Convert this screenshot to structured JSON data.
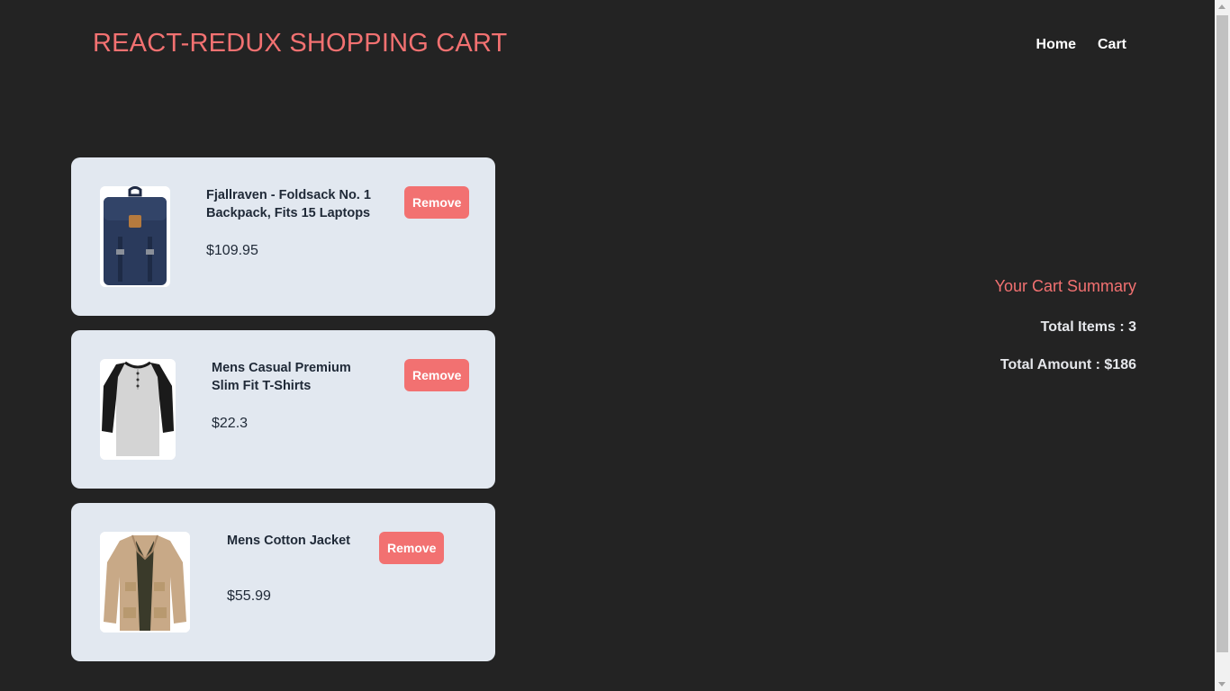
{
  "header": {
    "brand": "REACT-REDUX SHOPPING CART",
    "nav": {
      "home": "Home",
      "cart": "Cart"
    }
  },
  "cart": {
    "items": [
      {
        "title_line1": "Fjallraven - Foldsack No. 1",
        "title_line2": "Backpack, Fits 15 Laptops",
        "price": "$109.95",
        "remove_label": "Remove",
        "image": "backpack"
      },
      {
        "title_line1": "Mens Casual Premium",
        "title_line2": "Slim Fit T-Shirts",
        "price": "$22.3",
        "remove_label": "Remove",
        "image": "t-shirt"
      },
      {
        "title_line1": "Mens Cotton Jacket",
        "title_line2": "",
        "price": "$55.99",
        "remove_label": "Remove",
        "image": "jacket"
      }
    ]
  },
  "summary": {
    "heading": "Your Cart Summary",
    "total_items": "Total Items : 3",
    "total_amount": "Total Amount : $186"
  },
  "colors": {
    "background": "#232323",
    "accent": "#f27171",
    "card": "#e2e8f0"
  }
}
